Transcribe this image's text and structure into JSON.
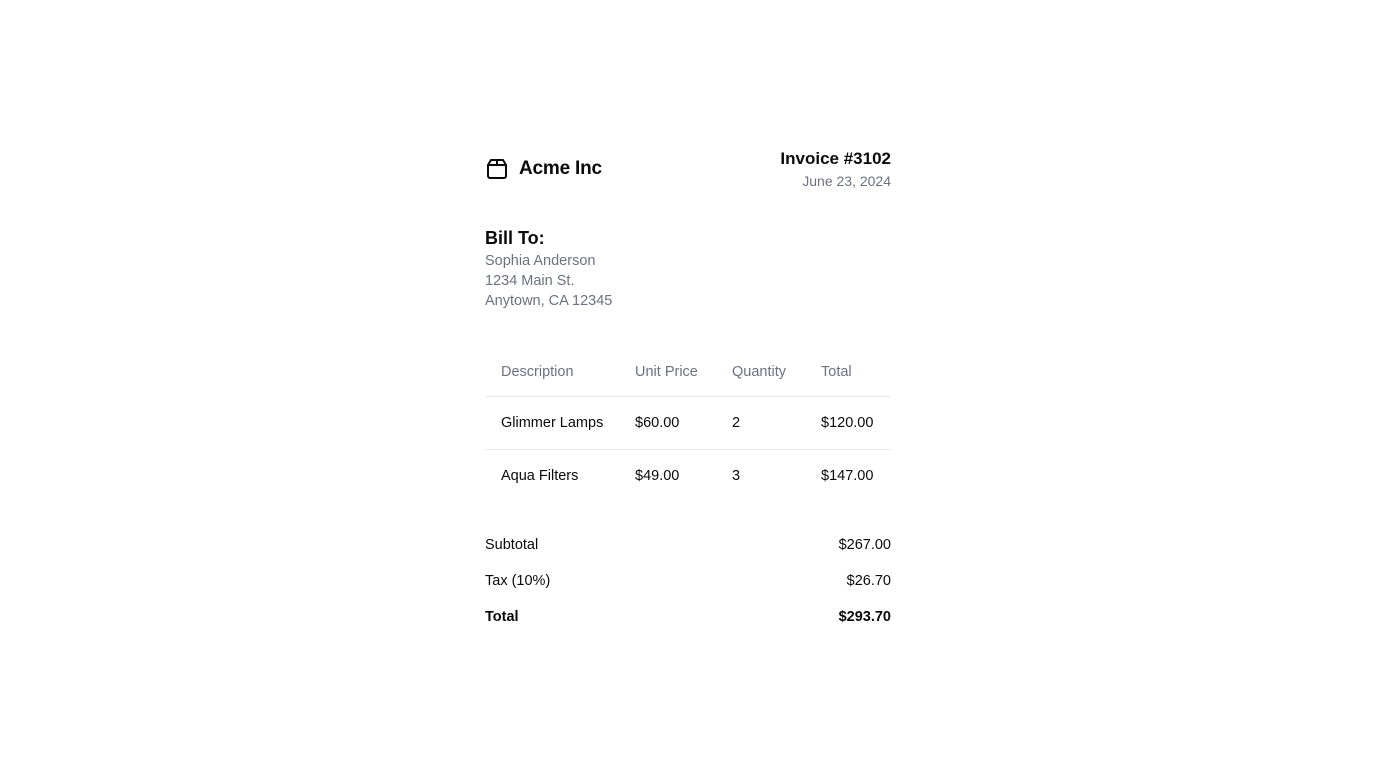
{
  "brand": {
    "name": "Acme Inc",
    "icon": "package-icon"
  },
  "invoice": {
    "number": "Invoice #3102",
    "date": "June 23, 2024"
  },
  "bill_to": {
    "heading": "Bill To:",
    "name": "Sophia Anderson",
    "street": "1234 Main St.",
    "city": "Anytown, CA 12345"
  },
  "table": {
    "headers": [
      "Description",
      "Unit Price",
      "Quantity",
      "Total"
    ],
    "rows": [
      [
        "Glimmer Lamps",
        "$60.00",
        "2",
        "$120.00"
      ],
      [
        "Aqua Filters",
        "$49.00",
        "3",
        "$147.00"
      ]
    ]
  },
  "totals": {
    "subtotal_label": "Subtotal",
    "subtotal_value": "$267.00",
    "tax_label": "Tax (10%)",
    "tax_value": "$26.70",
    "total_label": "Total",
    "total_value": "$293.70"
  },
  "colors": {
    "text": "#0a0a0a",
    "muted": "#6b7280",
    "border": "#e5e7eb"
  }
}
